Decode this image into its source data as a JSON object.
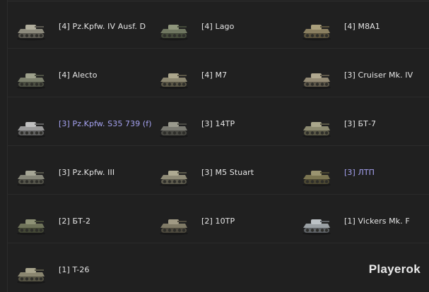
{
  "brand": "Playerok",
  "colors": {
    "background": "#202020",
    "text": "#e6e6e6",
    "premium": "#a6a3f2"
  },
  "vehicles": [
    {
      "label": "[4] Pz.Kpfw. IV Ausf. D",
      "premium": false,
      "icon": "tank-icon"
    },
    {
      "label": "[4] Lago",
      "premium": false,
      "icon": "tank-icon"
    },
    {
      "label": "[4] M8A1",
      "premium": false,
      "icon": "tank-icon"
    },
    {
      "label": "[4] Alecto",
      "premium": false,
      "icon": "tank-icon"
    },
    {
      "label": "[4] M7",
      "premium": false,
      "icon": "tank-icon"
    },
    {
      "label": "[3] Cruiser Mk. IV",
      "premium": false,
      "icon": "tank-icon"
    },
    {
      "label": "[3] Pz.Kpfw. S35 739 (f)",
      "premium": true,
      "icon": "tank-icon"
    },
    {
      "label": "[3] 14TP",
      "premium": false,
      "icon": "tank-icon"
    },
    {
      "label": "[3] БТ-7",
      "premium": false,
      "icon": "tank-icon"
    },
    {
      "label": "[3] Pz.Kpfw. III",
      "premium": false,
      "icon": "tank-icon"
    },
    {
      "label": "[3] M5 Stuart",
      "premium": false,
      "icon": "tank-icon"
    },
    {
      "label": "[3] ЛТП",
      "premium": true,
      "icon": "tank-icon"
    },
    {
      "label": "[2] БТ-2",
      "premium": false,
      "icon": "tank-icon"
    },
    {
      "label": "[2] 10TP",
      "premium": false,
      "icon": "tank-icon"
    },
    {
      "label": "[1] Vickers Mk. F",
      "premium": false,
      "icon": "tank-icon"
    },
    {
      "label": "[1] T-26",
      "premium": false,
      "icon": "tank-icon"
    }
  ]
}
